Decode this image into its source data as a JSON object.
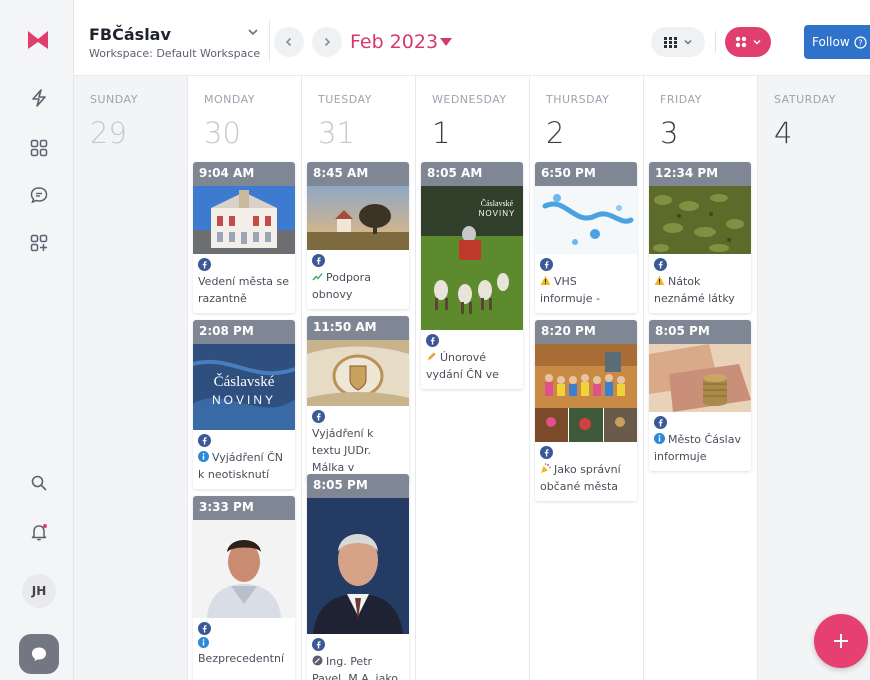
{
  "workspace": {
    "name": "FBČáslav",
    "subtitle": "Workspace: Default Workspace"
  },
  "calendar": {
    "month_label": "Feb 2023"
  },
  "header": {
    "follow_label": "Follow"
  },
  "user": {
    "initials": "JH"
  },
  "colors": {
    "accent": "#e03f6e",
    "month_text": "#d63a6a",
    "follow_button": "#2e72c9",
    "time_bar": "#7f8795",
    "facebook": "#3b5998"
  },
  "days": [
    {
      "name": "SUNDAY",
      "number": "29"
    },
    {
      "name": "MONDAY",
      "number": "30"
    },
    {
      "name": "TUESDAY",
      "number": "31"
    },
    {
      "name": "WEDNESDAY",
      "number": "1"
    },
    {
      "name": "THURSDAY",
      "number": "2"
    },
    {
      "name": "FRIDAY",
      "number": "3"
    },
    {
      "name": "SATURDAY",
      "number": "4"
    }
  ],
  "posts": {
    "mon1": {
      "time": "9:04 AM",
      "icon": "facebook-icon",
      "text": "Vedení města se razantně"
    },
    "mon2": {
      "time": "2:08 PM",
      "icon": "facebook-icon",
      "emoji": "info-icon",
      "text": "Vyjádření ČN k neotisknutí",
      "img_title": "Čáslavské",
      "img_subtitle": "NOVINY"
    },
    "mon3": {
      "time": "3:33 PM",
      "icon": "facebook-icon",
      "emoji": "info-icon",
      "text": "Bezprecedentní"
    },
    "tue1": {
      "time": "8:45 AM",
      "icon": "facebook-icon",
      "emoji": "chart-increasing-icon",
      "text": "Podpora obnovy"
    },
    "tue2": {
      "time": "11:50 AM",
      "icon": "facebook-icon",
      "text": "Vyjádření k textu JUDr. Málka v"
    },
    "tue3": {
      "time": "8:05 PM",
      "icon": "facebook-icon",
      "emoji": "pen-icon",
      "text": "Ing. Petr Pavel, M.A. jako"
    },
    "wed1": {
      "time": "8:05 AM",
      "icon": "facebook-icon",
      "emoji": "pencil-icon",
      "text": "Únorové vydání ČN ve",
      "img_title": "Čáslavské",
      "img_subtitle": "NOVINY"
    },
    "thu1": {
      "time": "6:50 PM",
      "icon": "facebook-icon",
      "emoji": "warning-icon",
      "text": "VHS informuje -"
    },
    "thu2": {
      "time": "8:20 PM",
      "icon": "facebook-icon",
      "emoji": "party-popper-icon",
      "text": "Jako správní občané města"
    },
    "fri1": {
      "time": "12:34 PM",
      "icon": "facebook-icon",
      "emoji": "warning-icon",
      "text": "Nátok neznámé látky"
    },
    "fri2": {
      "time": "8:05 PM",
      "icon": "facebook-icon",
      "emoji": "info-icon",
      "text": "Město Čáslav informuje"
    }
  }
}
